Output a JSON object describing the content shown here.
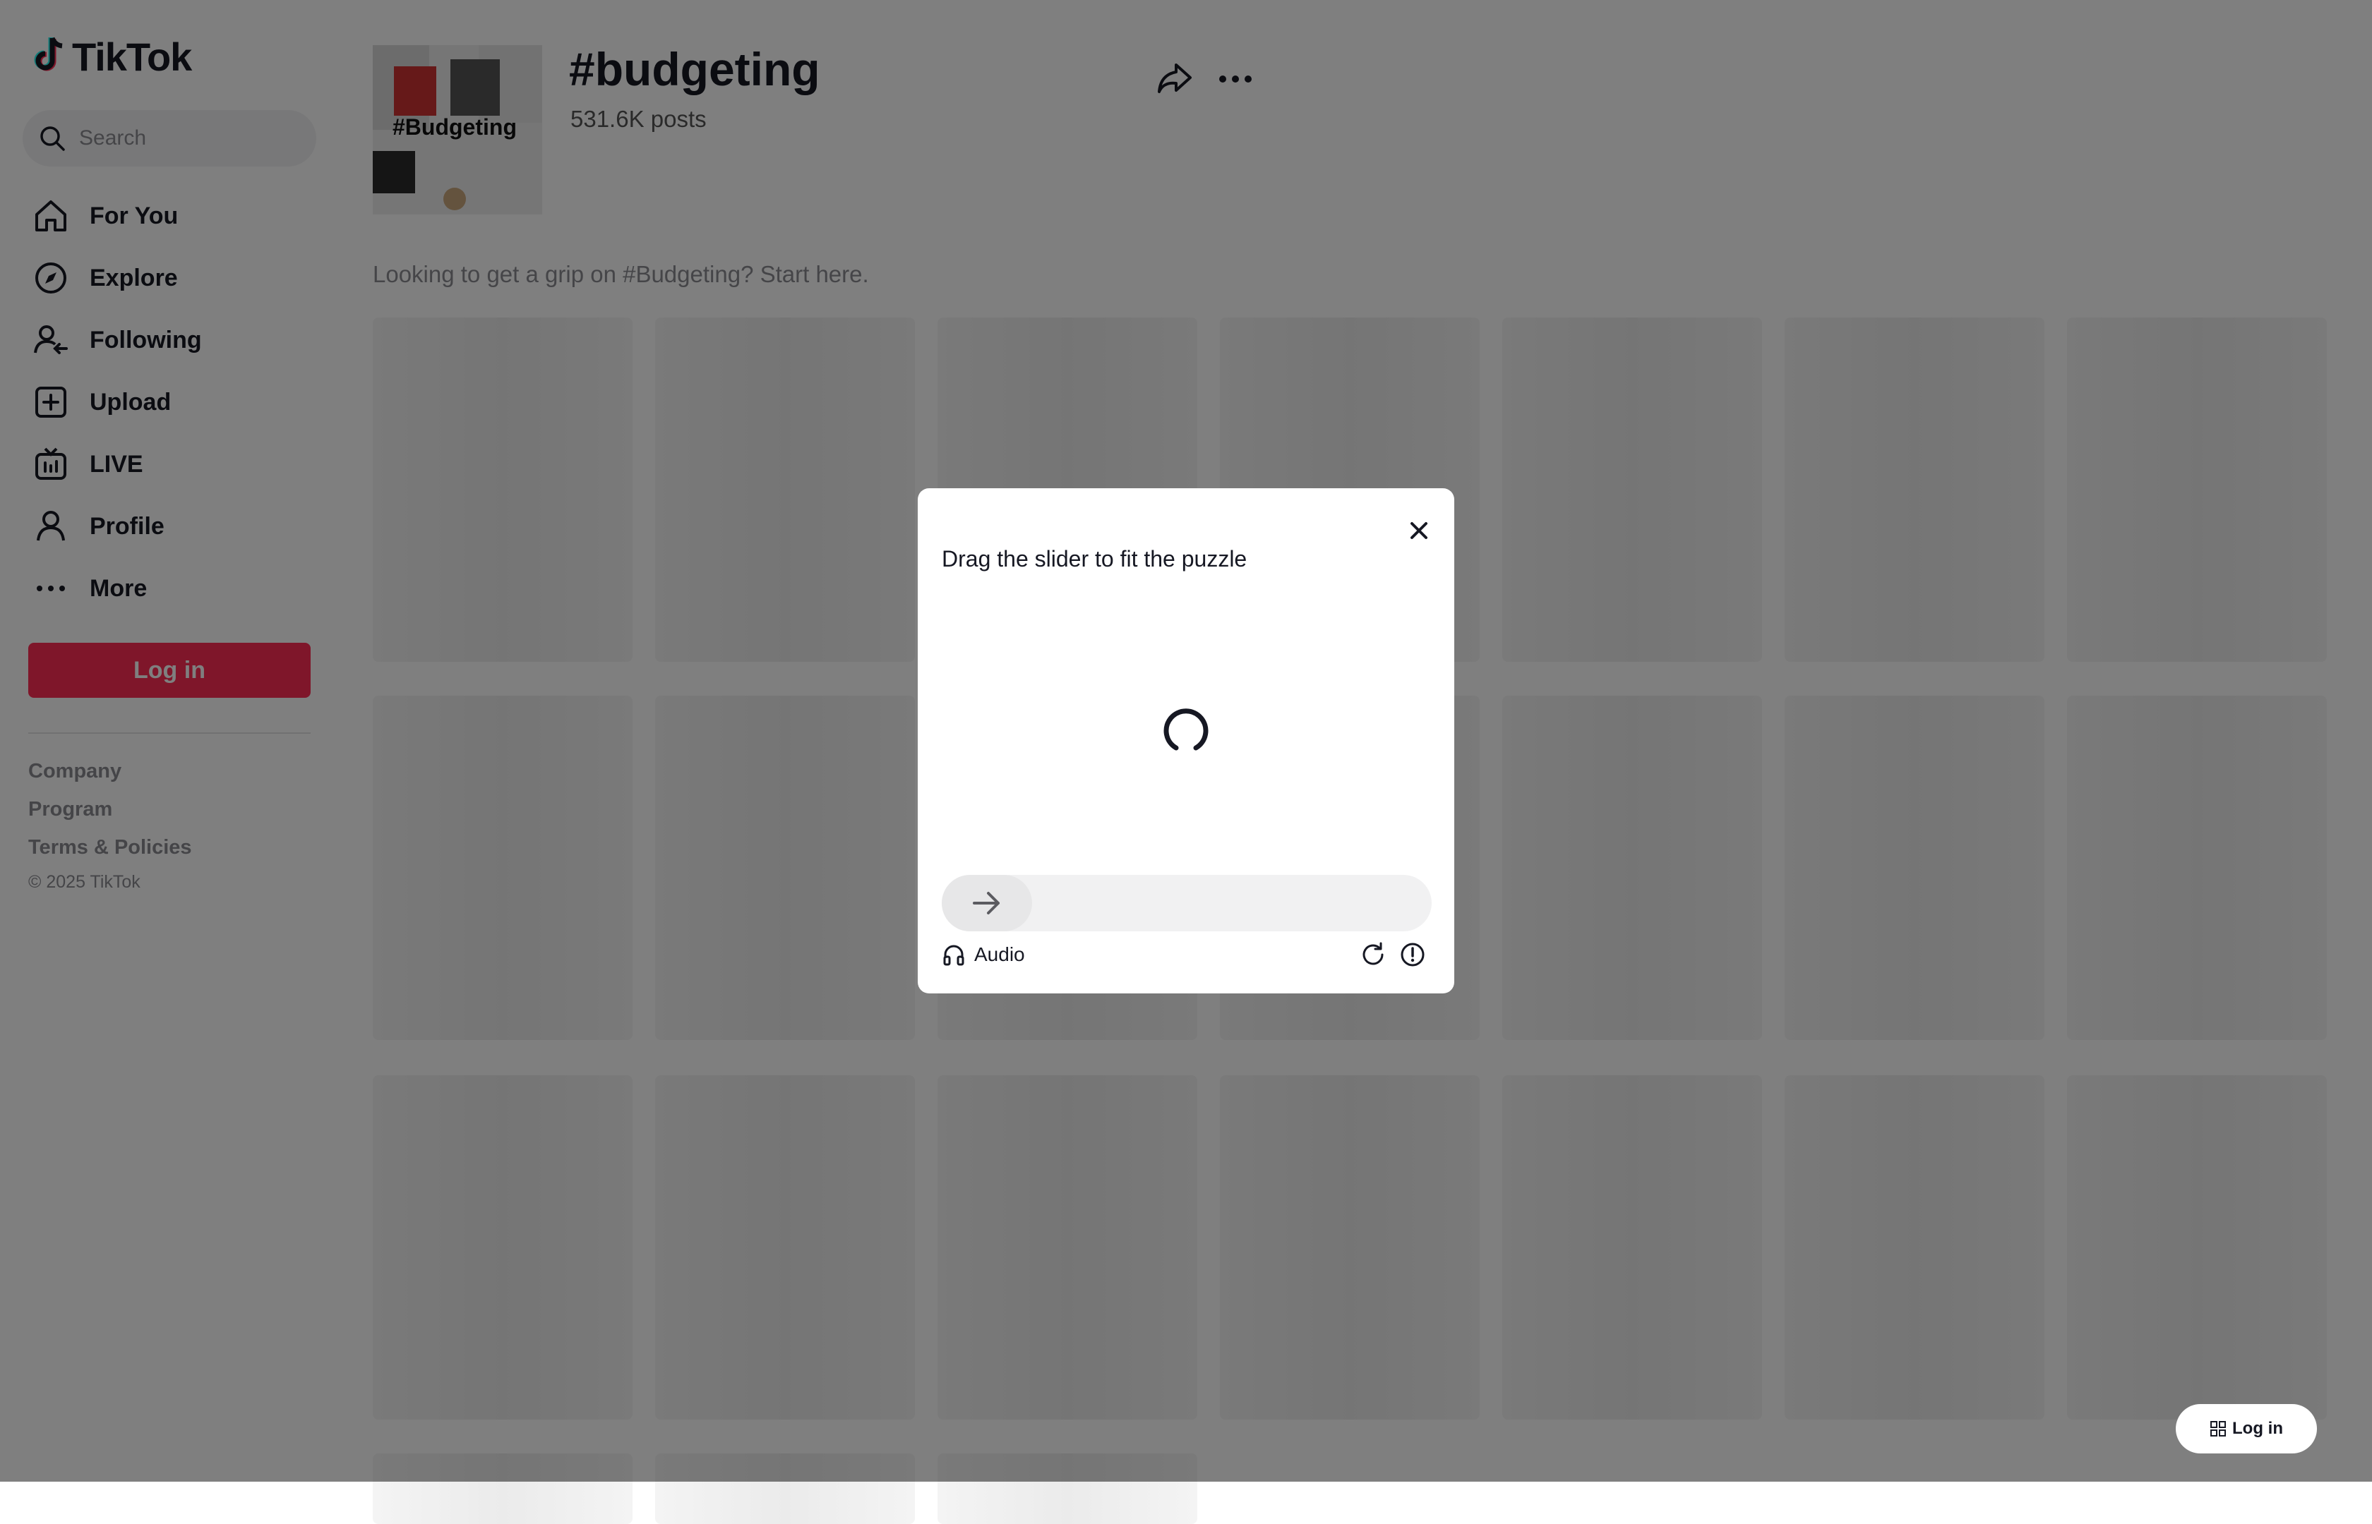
{
  "sidebar": {
    "logo_text": "TikTok",
    "search_placeholder": "Search",
    "nav": [
      {
        "label": "For You",
        "icon": "home-icon"
      },
      {
        "label": "Explore",
        "icon": "compass-icon"
      },
      {
        "label": "Following",
        "icon": "following-icon"
      },
      {
        "label": "Upload",
        "icon": "upload-icon"
      },
      {
        "label": "LIVE",
        "icon": "live-icon"
      },
      {
        "label": "Profile",
        "icon": "profile-icon"
      },
      {
        "label": "More",
        "icon": "more-icon"
      }
    ],
    "login_label": "Log in",
    "footer": {
      "links": [
        "Company",
        "Program",
        "Terms & Policies"
      ],
      "copyright": "© 2025 TikTok"
    }
  },
  "tag": {
    "thumb_text": "#Budgeting",
    "title": "#budgeting",
    "posts": "531.6K posts",
    "description": "Looking to get a grip on #Budgeting? Start here."
  },
  "float_login": "Log in",
  "captcha": {
    "title": "Drag the slider to fit the puzzle",
    "audio_label": "Audio"
  },
  "colors": {
    "brand": "#fe2c55",
    "text": "#161823",
    "overlay": "rgba(0,0,0,0.5)"
  }
}
